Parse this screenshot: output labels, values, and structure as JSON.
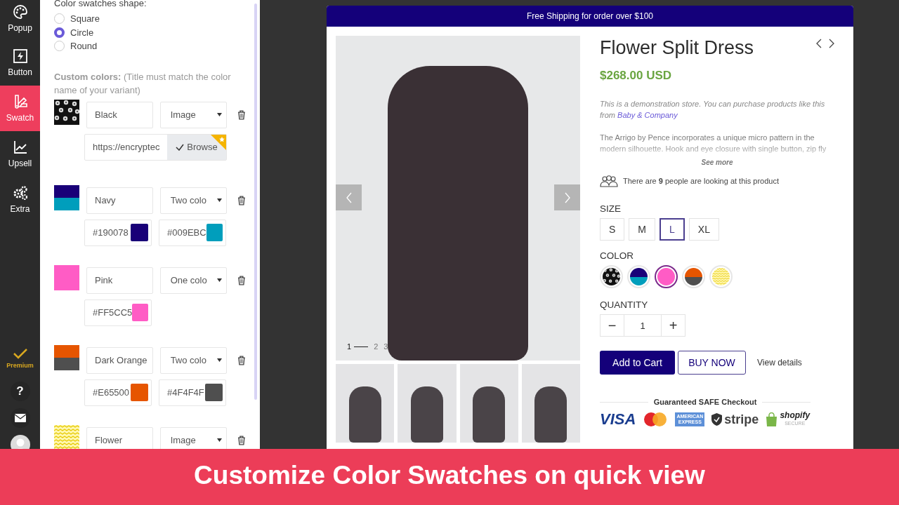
{
  "nav": {
    "items": [
      {
        "label": "Popup",
        "selected": false
      },
      {
        "label": "Button",
        "selected": false
      },
      {
        "label": "Swatch",
        "selected": true
      },
      {
        "label": "Upsell",
        "selected": false
      },
      {
        "label": "Extra",
        "selected": false
      }
    ],
    "premium": "Premium",
    "help": "?"
  },
  "settings": {
    "shape_title": "Color swatches shape:",
    "shapes": [
      {
        "label": "Square",
        "selected": false
      },
      {
        "label": "Circle",
        "selected": true
      },
      {
        "label": "Round",
        "selected": false
      }
    ],
    "custom_title": "**Custom colors:** (Title must match the color name of your variant)",
    "swatches": [
      {
        "kind": "image",
        "name": "Black",
        "type": "Image",
        "url": "https://encryptec",
        "browse": "Browse"
      },
      {
        "kind": "two",
        "name": "Navy",
        "type": "Two colo",
        "colors": [
          {
            "value": "#190078",
            "color": "#190078"
          },
          {
            "value": "#009EBC",
            "color": "#009ebc"
          }
        ]
      },
      {
        "kind": "one",
        "name": "Pink",
        "type": "One colo",
        "colors": [
          {
            "value": "#FF5CC5",
            "color": "#ff5cc5"
          }
        ]
      },
      {
        "kind": "two",
        "name": "Dark Orange",
        "type": "Two colo",
        "colors": [
          {
            "value": "#E65500",
            "color": "#e65500"
          },
          {
            "value": "#4F4F4F",
            "color": "#4f4f4f"
          }
        ]
      },
      {
        "kind": "image",
        "name": "Flower",
        "type": "Image"
      }
    ]
  },
  "quick_view": {
    "announcement": "Free Shipping for order over $100",
    "slides": [
      {
        "label": "1",
        "selected": true
      },
      {
        "label": "2",
        "selected": false
      },
      {
        "label": "3",
        "selected": false
      }
    ],
    "title": "Flower Split Dress",
    "price": "$268.00 USD",
    "note": "This is a demonstration store. You can purchase products like this from",
    "note_link": "Baby & Company",
    "description": "The Arrigo by Pence incorporates a unique micro pattern in the modern silhouette. Hook and eye closure with single button, zip fly",
    "see_more": "See more",
    "viewers": "There are **9** people are looking at this product",
    "size_label": "SIZE",
    "sizes": [
      {
        "label": "S",
        "selected": false
      },
      {
        "label": "M",
        "selected": false
      },
      {
        "label": "L",
        "selected": true
      },
      {
        "label": "XL",
        "selected": false
      }
    ],
    "color_label": "COLOR",
    "colors": [
      {
        "selected": false
      },
      {
        "selected": false
      },
      {
        "selected": true
      },
      {
        "selected": false
      },
      {
        "selected": false
      }
    ],
    "quantity_label": "QUANTITY",
    "quantity": "1",
    "minus": "−",
    "plus": "+",
    "add_to_cart": "Add to Cart",
    "buy_now": "BUY NOW",
    "view_details": "View details",
    "checkout_title": "Guaranteed SAFE Checkout",
    "payments": {
      "visa": "VISA",
      "amex": "AMERICAN EXPRESS",
      "stripe": "stripe",
      "shopify": "shopify",
      "shopify_sub": "SECURE"
    }
  },
  "banner": "Customize Color Swatches on quick view"
}
